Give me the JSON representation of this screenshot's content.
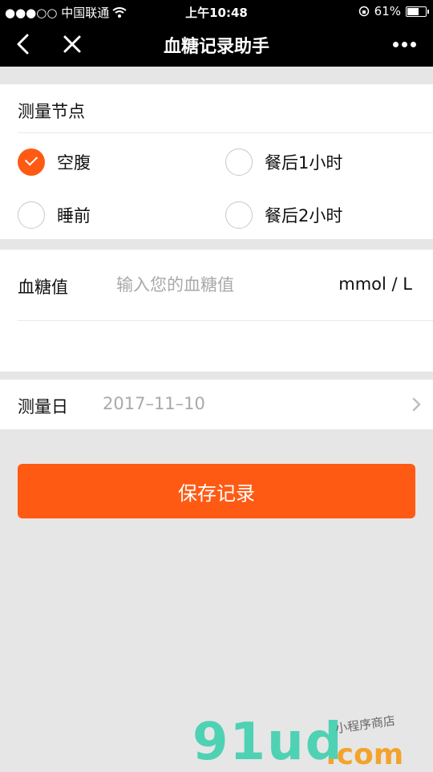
{
  "status_bar": {
    "carrier": "●●●○○ 中国联通",
    "time": "上午10:48",
    "battery_percent": "61%"
  },
  "nav": {
    "title": "血糖记录助手",
    "back_icon": "back-arrow-icon",
    "close_icon": "close-icon",
    "more_icon": "more-dots-icon"
  },
  "measure_point": {
    "title": "测量节点",
    "options": [
      {
        "label": "空腹",
        "checked": true
      },
      {
        "label": "餐后1小时",
        "checked": false
      },
      {
        "label": "睡前",
        "checked": false
      },
      {
        "label": "餐后2小时",
        "checked": false
      }
    ]
  },
  "glucose": {
    "label": "血糖值",
    "placeholder": "输入您的血糖值",
    "unit": "mmol / L"
  },
  "date": {
    "label": "测量日",
    "value": "2017–11–10"
  },
  "actions": {
    "save_label": "保存记录"
  },
  "colors": {
    "accent": "#ff5a13",
    "page_background": "#e6e6e6",
    "navbar": "#000000"
  },
  "watermark": {
    "brand": "91ud",
    "domain": ".com",
    "tagline": "小程序商店"
  }
}
